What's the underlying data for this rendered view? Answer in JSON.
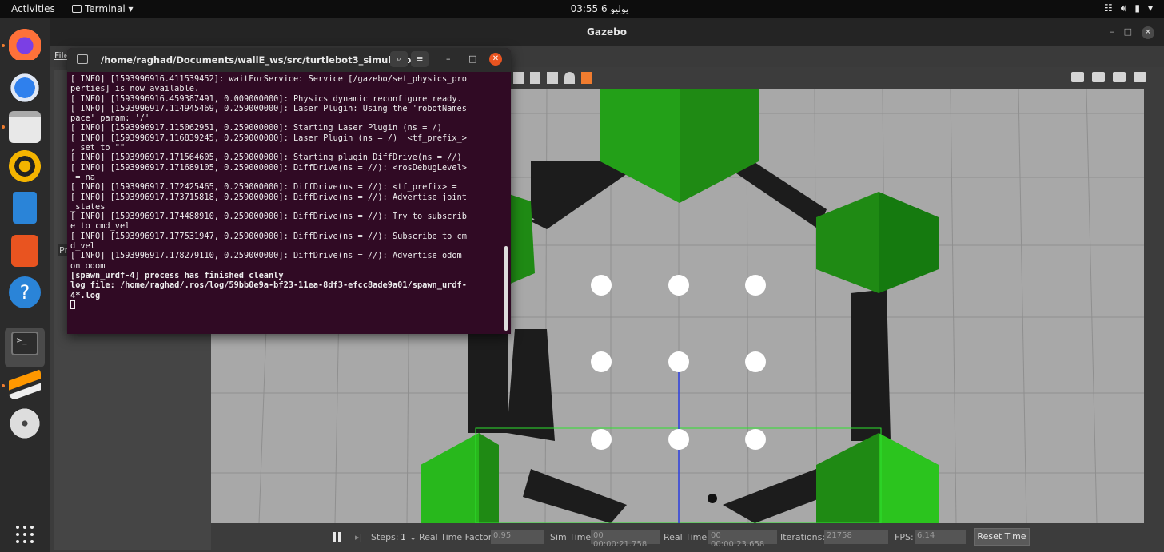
{
  "topbar": {
    "activities": "Activities",
    "app_menu": "Terminal ▾",
    "clock": "03:55 6 يوليو",
    "tray": [
      "network-icon",
      "volume-icon",
      "battery-icon",
      "menu-arrow-icon"
    ]
  },
  "dock": {
    "items": [
      "firefox-icon",
      "thunderbird-icon",
      "files-icon",
      "rhythmbox-icon",
      "writer-icon",
      "software-icon",
      "help-icon",
      "terminal-icon",
      "sublime-icon",
      "dvd-icon"
    ],
    "apps_grid": "show-applications-icon"
  },
  "gazebo": {
    "title": "Gazebo",
    "menu_file": "File",
    "left_panel_tab": "Pr",
    "bottom": {
      "steps_label": "Steps:",
      "steps_value": "1",
      "rtf_label": "Real Time Factor:",
      "rtf_value": "0.95",
      "sim_time_label": "Sim Time:",
      "sim_time_value": "00 00:00:21.758",
      "real_time_label": "Real Time:",
      "real_time_value": "00 00:00:23.658",
      "iterations_label": "Iterations:",
      "iterations_value": "21758",
      "fps_label": "FPS:",
      "fps_value": "6.14",
      "reset_label": "Reset Time"
    }
  },
  "terminal": {
    "title": "/home/raghad/Documents/wallE_ws/src/turtlebot3_simulation...",
    "lines": [
      "[ INFO] [1593996916.411539452]: waitForService: Service [/gazebo/set_physics_pro",
      "perties] is now available.",
      "[ INFO] [1593996916.459387491, 0.009000000]: Physics dynamic reconfigure ready.",
      "[ INFO] [1593996917.114945469, 0.259000000]: Laser Plugin: Using the 'robotNames",
      "pace' param: '/'",
      "[ INFO] [1593996917.115062951, 0.259000000]: Starting Laser Plugin (ns = /)",
      "[ INFO] [1593996917.116839245, 0.259000000]: Laser Plugin (ns = /)  <tf_prefix_>",
      ", set to \"\"",
      "[ INFO] [1593996917.171564605, 0.259000000]: Starting plugin DiffDrive(ns = //)",
      "[ INFO] [1593996917.171689105, 0.259000000]: DiffDrive(ns = //): <rosDebugLevel>",
      " = na",
      "[ INFO] [1593996917.172425465, 0.259000000]: DiffDrive(ns = //): <tf_prefix> =",
      "[ INFO] [1593996917.173715818, 0.259000000]: DiffDrive(ns = //): Advertise joint",
      "_states",
      "[ INFO] [1593996917.174488910, 0.259000000]: DiffDrive(ns = //): Try to subscrib",
      "e to cmd_vel",
      "[ INFO] [1593996917.177531947, 0.259000000]: DiffDrive(ns = //): Subscribe to cm",
      "d_vel",
      "[ INFO] [1593996917.178279110, 0.259000000]: DiffDrive(ns = //): Advertise odom",
      "on odom"
    ],
    "bold_lines": [
      "[spawn_urdf-4] process has finished cleanly",
      "log file: /home/raghad/.ros/log/59bb0e9a-bf23-11ea-8df3-efcc8ade9a01/spawn_urdf-",
      "4*.log"
    ]
  }
}
